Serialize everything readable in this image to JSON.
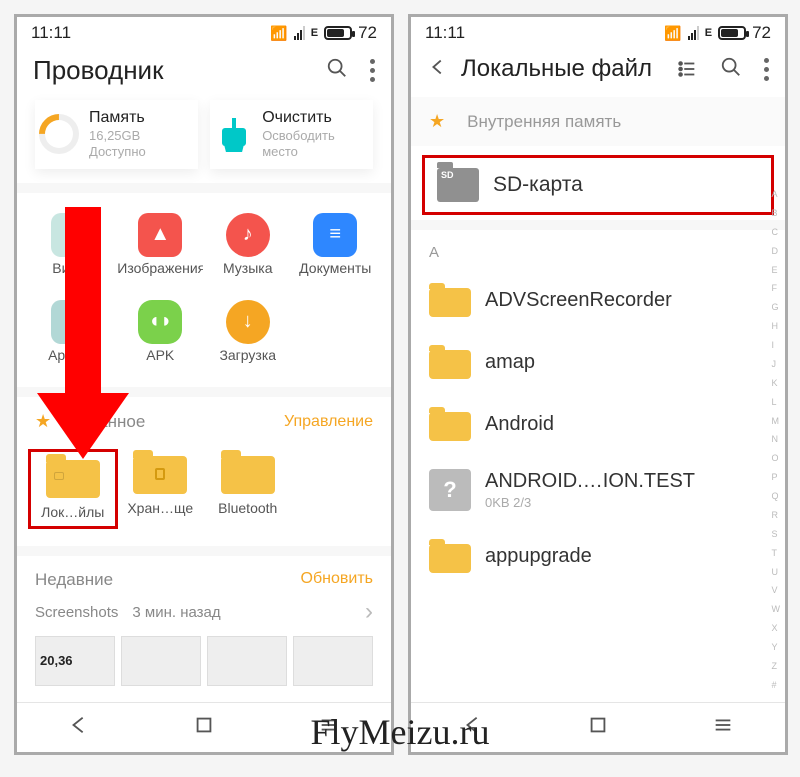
{
  "status": {
    "time": "11:11",
    "net": "E",
    "battery": "72"
  },
  "p1": {
    "title": "Проводник",
    "memory": {
      "label": "Память",
      "value": "16,25GB",
      "sub": "Доступно"
    },
    "clean": {
      "label": "Очистить",
      "sub": "Освободить место"
    },
    "cats": {
      "video": "Видео",
      "images": "Изображения",
      "music": "Музыка",
      "docs": "Документы",
      "arch": "Архивы",
      "apk": "APK",
      "dl": "Загрузка"
    },
    "fav": {
      "title": "Избранное",
      "manage": "Управление"
    },
    "favItems": {
      "local": "Лок…йлы",
      "vault": "Хран…ще",
      "bt": "Bluetooth"
    },
    "recent": {
      "title": "Недавние",
      "update": "Обновить",
      "shots": "Screenshots",
      "time": "3 мин. назад"
    }
  },
  "p2": {
    "title": "Локальные файл",
    "fav": "Внутренняя память",
    "sd": "SD-карта",
    "sectionA": "A",
    "rows": {
      "r1": "ADVScreenRecorder",
      "r2": "amap",
      "r3": "Android",
      "r4": {
        "name": "ANDROID.…ION.TEST",
        "sub": "0KB  2/3"
      },
      "r5": "appupgrade"
    },
    "index": [
      "A",
      "B",
      "C",
      "D",
      "E",
      "F",
      "G",
      "H",
      "I",
      "J",
      "K",
      "L",
      "M",
      "N",
      "O",
      "P",
      "Q",
      "R",
      "S",
      "T",
      "U",
      "V",
      "W",
      "X",
      "Y",
      "Z",
      "#"
    ]
  },
  "watermark": "FlyMeizu.ru"
}
